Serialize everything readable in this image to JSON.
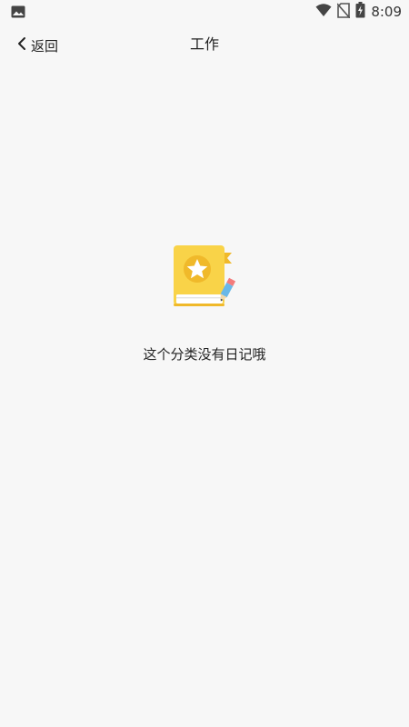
{
  "status_bar": {
    "time": "8:09",
    "icons": [
      "image-notification-icon",
      "wifi-icon",
      "no-sim-icon",
      "battery-charging-icon"
    ]
  },
  "header": {
    "back_label": "返回",
    "title": "工作"
  },
  "empty_state": {
    "illustration": "diary-book-star-icon",
    "message": "这个分类没有日记哦"
  },
  "colors": {
    "background": "#f7f7f7",
    "book_yellow": "#f9d348",
    "book_dark_yellow": "#f0b92a",
    "star_white": "#ffffff",
    "pencil_blue": "#6ab8e8",
    "pencil_red": "#f47c7c"
  }
}
